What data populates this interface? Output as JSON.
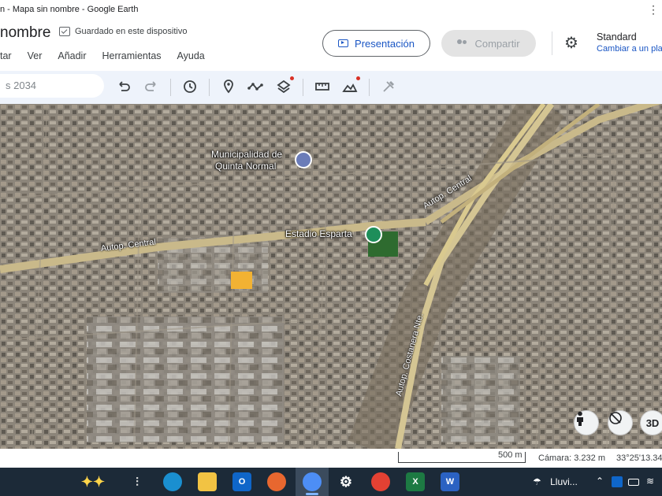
{
  "window": {
    "title": "n - Mapa sin nombre - Google Earth"
  },
  "header": {
    "doc_title": "nombre",
    "saved_status": "Guardado en este dispositivo",
    "menu": [
      "tar",
      "Ver",
      "Añadir",
      "Herramientas",
      "Ayuda"
    ],
    "present_label": "Presentación",
    "share_label": "Compartir",
    "map_style_title": "Standard",
    "map_style_link": "Cambiar a un pla"
  },
  "toolbar": {
    "search_text": "s 2034",
    "icons": [
      "undo-icon",
      "redo-icon",
      "history-icon",
      "placemark-icon",
      "path-icon",
      "layers-icon",
      "ruler-icon",
      "elevation-icon",
      "tools-icon"
    ]
  },
  "map": {
    "places": {
      "municipality_line1": "Municipalidad de",
      "municipality_line2": "Quinta Normal",
      "stadium": "Estadio Esparta"
    },
    "roads": {
      "autop_central_west": "Autop. Central",
      "autop_central_east": "Autop. Central",
      "costanera": "Autop. Costanera Nte."
    },
    "controls": {
      "pegman": "pegman-icon",
      "compass": "compass-icon",
      "view3d": "3D"
    }
  },
  "status": {
    "scale": "500 m",
    "camera": "Cámara: 3.232 m",
    "coordinates": "33°25'13.34"
  },
  "taskbar": {
    "apps": [
      "copilot-icon",
      "task-view-icon",
      "edge-icon",
      "file-explorer-icon",
      "outlook-icon",
      "firefox-icon",
      "google-earth-icon",
      "settings-icon",
      "chrome-icon",
      "excel-icon",
      "word-icon"
    ],
    "weather": "Lluvi...",
    "colors": {
      "bg": "#1c2a38",
      "accent": "#7fb4ff"
    }
  }
}
